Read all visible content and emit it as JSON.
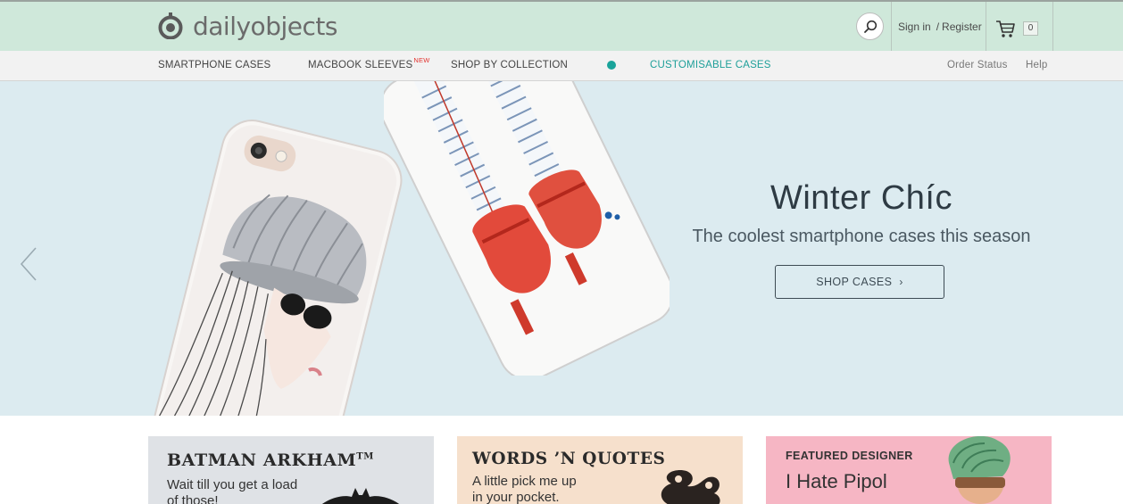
{
  "header": {
    "logo_text": "dailyobjects",
    "sign_in": "Sign in",
    "separator": "/",
    "register": "Register",
    "cart_count": "0",
    "colors": {
      "topbar": "#cfe8da",
      "accent": "#19a39a"
    }
  },
  "nav": {
    "items": [
      {
        "label": "SMARTPHONE CASES"
      },
      {
        "label": "MACBOOK SLEEVES",
        "badge": "NEW"
      },
      {
        "label": "SHOP BY COLLECTION"
      },
      {
        "label": "CUSTOMISABLE CASES"
      }
    ],
    "right": {
      "order_status": "Order Status",
      "help": "Help"
    }
  },
  "hero": {
    "title": "Winter Chíc",
    "subtitle": "The coolest smartphone cases this season",
    "cta": "SHOP CASES",
    "background": "#dcebf0"
  },
  "cards": [
    {
      "title": "BATMAN ARKHAM",
      "trademark": "TM",
      "text_line1": "Wait till you get a load",
      "text_line2": "of those!"
    },
    {
      "title": "WORDS ’N QUOTES",
      "text_line1": "A little pick me up",
      "text_line2": "in your pocket."
    },
    {
      "label": "FEATURED DESIGNER",
      "name": "I Hate Pipol"
    }
  ]
}
